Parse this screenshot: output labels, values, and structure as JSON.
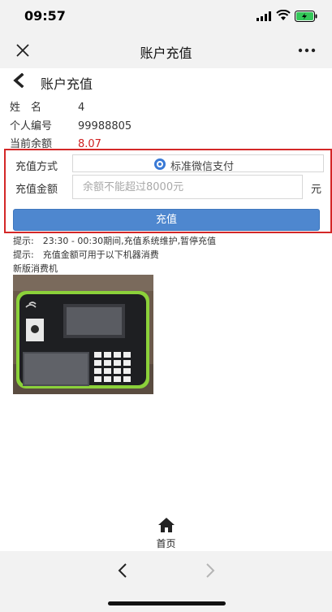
{
  "status_bar": {
    "time": "09:57"
  },
  "nav": {
    "title": "账户充值"
  },
  "page": {
    "title": "账户充值"
  },
  "account": {
    "name_label": "姓　名",
    "name_value": "4",
    "id_label": "个人编号",
    "id_value": "99988805",
    "balance_label": "当前余额",
    "balance_value": "8.07"
  },
  "form": {
    "method_label": "充值方式",
    "method_option": "标准微信支付",
    "amount_label": "充值金额",
    "amount_placeholder": "余额不能超过8000元",
    "amount_value": "",
    "unit": "元",
    "submit_label": "充值"
  },
  "tips": {
    "line1": "提示:　23:30 - 00:30期间,充值系统维护,暂停充值",
    "line2": "提示:　充值金额可用于以下机器消费",
    "line3": "新版消费机"
  },
  "tabbar": {
    "home_label": "首页"
  },
  "colors": {
    "accent": "#4e87cf",
    "highlight_border": "#d42828",
    "balance": "#d02020"
  }
}
